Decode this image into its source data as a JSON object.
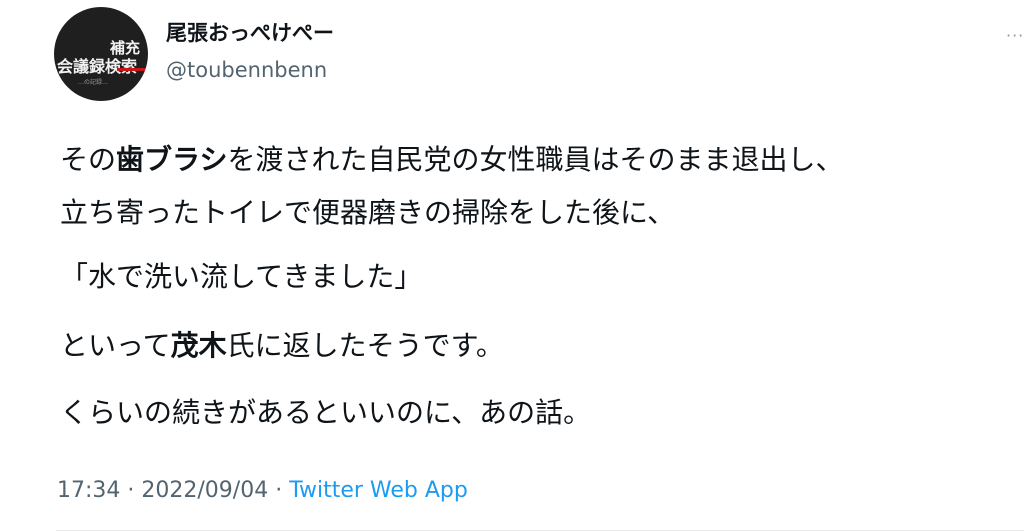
{
  "author": {
    "display_name": "尾張おっぺけぺー",
    "handle": "@toubennbenn",
    "avatar_text": {
      "top": "補充",
      "main": "会議録検索",
      "small": "…の記録…"
    }
  },
  "tweet": {
    "line1_a": "その",
    "line1_b": "歯ブラシ",
    "line1_c": "を渡された自民党の女性職員はそのまま退出し、",
    "line2": "立ち寄ったトイレで便器磨きの掃除をした後に、",
    "line3": "「水で洗い流してきました」",
    "line4_a": "といって",
    "line4_b": "茂木",
    "line4_c": "氏に返したそうです。",
    "line5": "くらいの続きがあるといいのに、あの話。"
  },
  "meta": {
    "time": "17:34",
    "sep1": " · ",
    "date": "2022/09/04",
    "sep2": " · ",
    "source": "Twitter Web App"
  },
  "menu": {
    "more_glyph": "···"
  }
}
